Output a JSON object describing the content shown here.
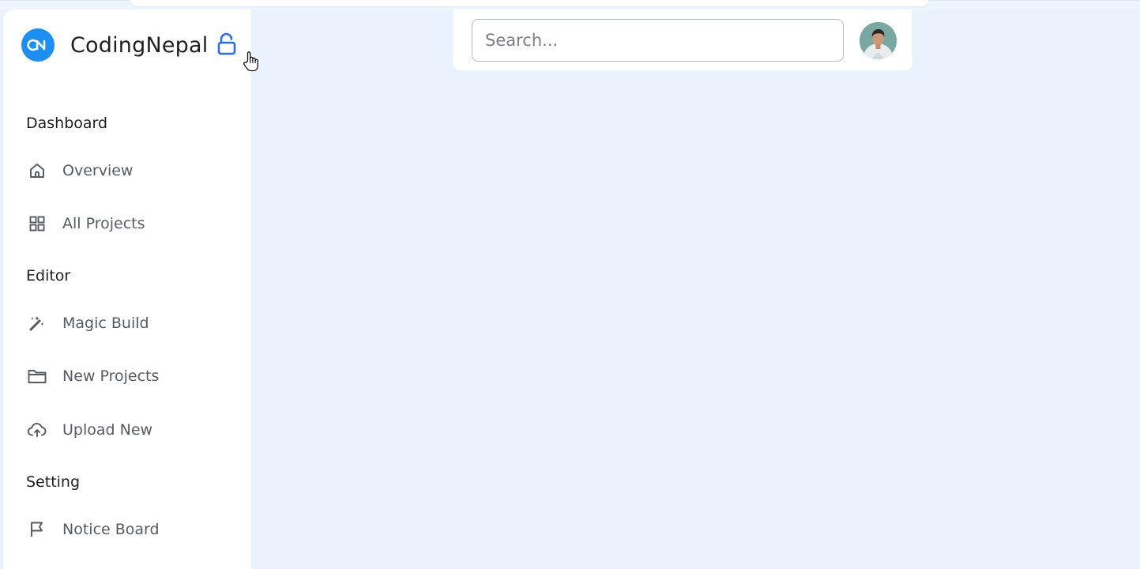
{
  "brand": {
    "name": "CodingNepal",
    "logo_icon": "codingnepal-logo-icon",
    "accent": "#1e8ef1"
  },
  "lock": {
    "icon": "lock-open-icon",
    "color": "#2f6fe4"
  },
  "sidebar": {
    "sections": [
      {
        "title": "Dashboard",
        "items": [
          {
            "label": "Overview",
            "icon": "home-icon"
          },
          {
            "label": "All Projects",
            "icon": "grid-icon"
          }
        ]
      },
      {
        "title": "Editor",
        "items": [
          {
            "label": "Magic Build",
            "icon": "magic-wand-icon"
          },
          {
            "label": "New Projects",
            "icon": "folder-icon"
          },
          {
            "label": "Upload New",
            "icon": "cloud-upload-icon"
          }
        ]
      },
      {
        "title": "Setting",
        "items": [
          {
            "label": "Notice Board",
            "icon": "flag-icon"
          }
        ]
      }
    ]
  },
  "navbar": {
    "search": {
      "placeholder": "Search...",
      "value": ""
    },
    "avatar": "user-avatar"
  },
  "colors": {
    "background": "#eaf2fd",
    "sidebar": "#ffffff",
    "text_muted": "#555a63"
  }
}
